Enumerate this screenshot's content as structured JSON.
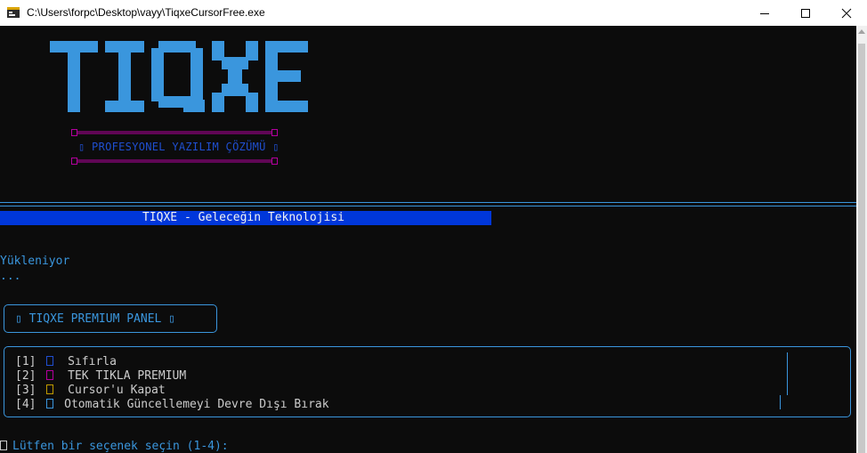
{
  "window": {
    "title": "C:\\Users\\forpc\\Desktop\\vayy\\TiqxeCursorFree.exe",
    "controls": [
      "minimize",
      "maximize",
      "close"
    ]
  },
  "logo": {
    "text": "TIQXE",
    "color": "#3a96dd"
  },
  "subtitle": {
    "text": "▯ PROFESYONEL YAZILIM ÇÖZÜMÜ ▯",
    "color": "#1f4fd1"
  },
  "banner": {
    "text": "TIQXE - Geleceğin Teknolojisi",
    "background": "#0037da"
  },
  "status": {
    "loading": "Yükleniyor",
    "dots": "..."
  },
  "panel": {
    "title": "▯ TIQXE PREMIUM PANEL ▯"
  },
  "menu": {
    "items": [
      {
        "num": "[1]",
        "label": "Sıfırla",
        "icon": "box-glyph-icon",
        "icon_color": "#1f4fd1"
      },
      {
        "num": "[2]",
        "label": "TEK TIKLA PREMIUM",
        "icon": "box-glyph-icon",
        "icon_color": "#b4009e"
      },
      {
        "num": "[3]",
        "label": "Cursor'u Kapat",
        "icon": "box-glyph-icon",
        "icon_color": "#c19c00"
      },
      {
        "num": "[4]",
        "label": "Otomatik Güncellemeyi Devre Dışı Bırak",
        "icon": "box-glyph-icon",
        "icon_color": "#3a96dd"
      }
    ]
  },
  "prompt": {
    "text": "Lütfen bir seçenek seçin (1-4):"
  },
  "colors": {
    "accent": "#3a96dd",
    "background": "#0c0c0c",
    "frame": "#b4009e"
  }
}
